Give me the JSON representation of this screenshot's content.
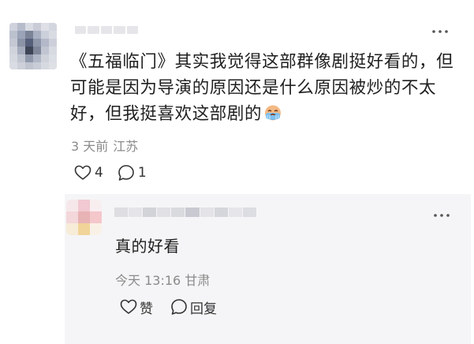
{
  "comment": {
    "content": "《五福临门》其实我觉得这部群像剧挺好看的，但可能是因为导演的原因还是什么原因被炒的不太好，但我挺喜欢这部剧的",
    "emoji_icon": "crying-face-emoji",
    "meta": {
      "time": "3 天前",
      "location": "江苏"
    },
    "actions": {
      "like_count": "4",
      "reply_count": "1"
    },
    "more_icon": "more-dots-icon"
  },
  "reply": {
    "content": "真的好看",
    "meta": {
      "time": "今天 13:16",
      "location": "甘肃"
    },
    "actions": {
      "like_label": "赞",
      "reply_label": "回复"
    },
    "more_icon": "more-dots-icon"
  },
  "colors": {
    "text": "#1f1f1f",
    "meta": "#8a8a8a",
    "reply_background": "#f5f5f7"
  }
}
